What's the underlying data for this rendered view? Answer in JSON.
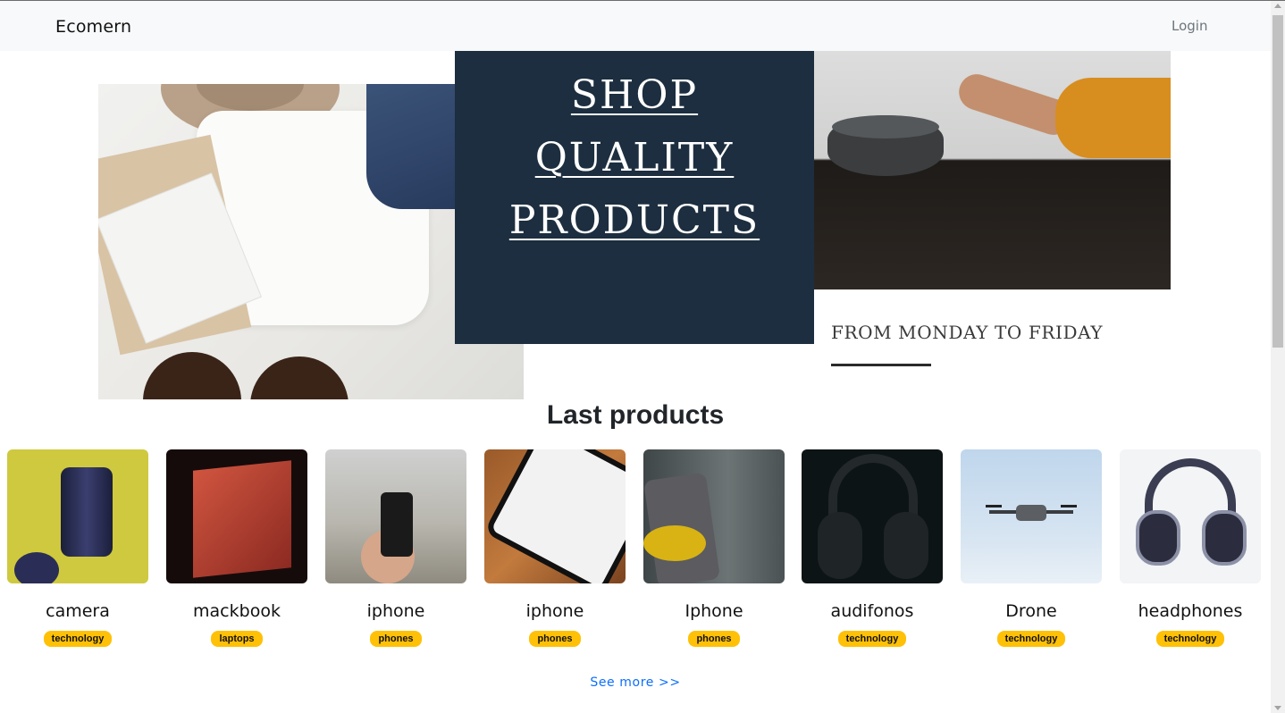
{
  "navbar": {
    "brand": "Ecomern",
    "login": "Login"
  },
  "banner": {
    "headline_lines": [
      "SHOP",
      "QUALITY",
      "PRODUCTS"
    ],
    "subline": "FROM MONDAY TO FRIDAY"
  },
  "products_section": {
    "title": "Last products",
    "items": [
      {
        "name": "camera",
        "category": "technology"
      },
      {
        "name": "mackbook",
        "category": "laptops"
      },
      {
        "name": "iphone",
        "category": "phones"
      },
      {
        "name": "iphone",
        "category": "phones"
      },
      {
        "name": "Iphone",
        "category": "phones"
      },
      {
        "name": "audifonos",
        "category": "technology"
      },
      {
        "name": "Drone",
        "category": "technology"
      },
      {
        "name": "headphones",
        "category": "technology"
      }
    ],
    "see_more": "See more >>"
  },
  "colors": {
    "navbar_bg": "#f8f9fa",
    "badge": "#ffc107",
    "link": "#0d6efd",
    "banner_panel": "#1c2e3f"
  }
}
